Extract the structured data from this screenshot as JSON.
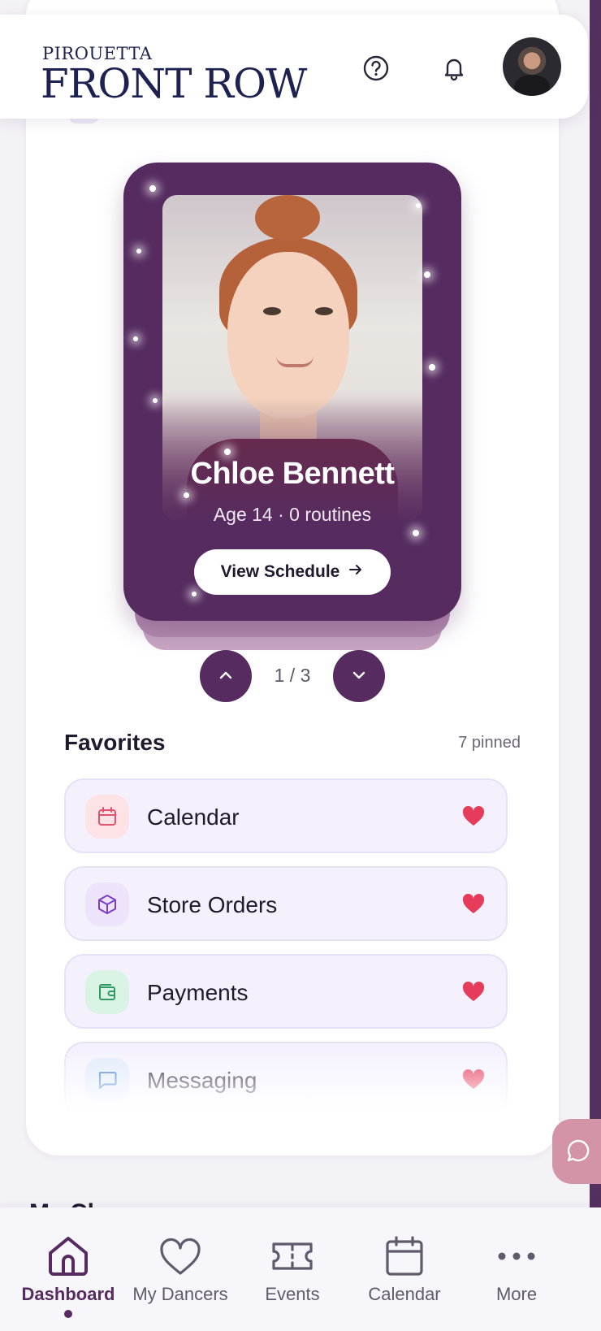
{
  "header": {
    "logo_top": "PIROUETTA",
    "logo_main": "FRONT ROW"
  },
  "dancer_card": {
    "name": "Chloe Bennett",
    "meta": "Age 14 · 0 routines",
    "view_button_label": "View Schedule"
  },
  "pager": {
    "label": "1 / 3"
  },
  "favorites": {
    "title": "Favorites",
    "count_label": "7 pinned",
    "items": [
      {
        "label": "Calendar",
        "icon": "calendar-icon",
        "color": "#e0536e",
        "bg": "#fde2e6"
      },
      {
        "label": "Store Orders",
        "icon": "box-icon",
        "color": "#7b3fc4",
        "bg": "#ede4fb"
      },
      {
        "label": "Payments",
        "icon": "wallet-icon",
        "color": "#2f9b62",
        "bg": "#d9f4e4"
      },
      {
        "label": "Messaging",
        "icon": "message-icon",
        "color": "#3a78d6",
        "bg": "#dfeafb"
      }
    ]
  },
  "next_section_peek": "My Cl",
  "bottom_nav": {
    "items": [
      {
        "label": "Dashboard",
        "active": true
      },
      {
        "label": "My Dancers",
        "active": false
      },
      {
        "label": "Events",
        "active": false
      },
      {
        "label": "Calendar",
        "active": false
      },
      {
        "label": "More",
        "active": false
      }
    ]
  },
  "colors": {
    "brand": "#562c60",
    "heart": "#e63b5a",
    "chat_fab": "#d394a8"
  }
}
